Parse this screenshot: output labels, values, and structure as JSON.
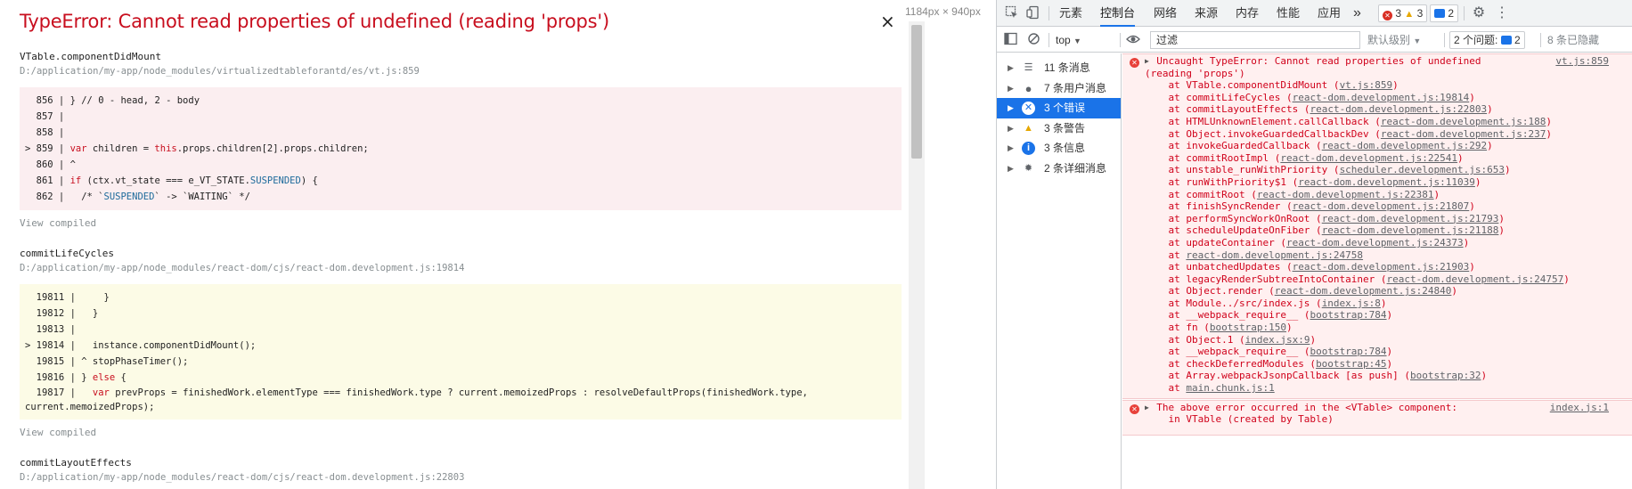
{
  "overlay": {
    "title": "TypeError: Cannot read properties of undefined (reading 'props')",
    "close_glyph": "×",
    "dims": "1184px × 940px",
    "view_compiled": "View compiled",
    "frames": [
      {
        "fn": "VTable.componentDidMount",
        "path": "D:/application/my-app/node_modules/virtualizedtableforantd/es/vt.js:859",
        "bg": "red",
        "lines": [
          {
            "prefix": "  856 | ",
            "code": "} // 0 - head, 2 - body"
          },
          {
            "prefix": "  857 | ",
            "code": ""
          },
          {
            "prefix": "  858 | ",
            "code": ""
          },
          {
            "prefix": "> 859 | ",
            "code": "var children = this.props.children[2].props.children;"
          },
          {
            "prefix": "  860 | ",
            "code": "^"
          },
          {
            "prefix": "  861 | ",
            "code": "if (ctx.vt_state === e_VT_STATE.SUSPENDED) {"
          },
          {
            "prefix": "  862 | ",
            "code": "  /* `SUSPENDED` -> `WAITING` */"
          }
        ]
      },
      {
        "fn": "commitLifeCycles",
        "path": "D:/application/my-app/node_modules/react-dom/cjs/react-dom.development.js:19814",
        "bg": "yellow",
        "lines": [
          {
            "prefix": "  19811 | ",
            "code": "    }"
          },
          {
            "prefix": "  19812 | ",
            "code": "  }"
          },
          {
            "prefix": "  19813 | ",
            "code": ""
          },
          {
            "prefix": "> 19814 | ",
            "code": "  instance.componentDidMount();"
          },
          {
            "prefix": "  19815 | ",
            "code": "^ stopPhaseTimer();"
          },
          {
            "prefix": "  19816 | ",
            "code": "} else {"
          },
          {
            "prefix": "  19817 | ",
            "code": "  var prevProps = finishedWork.elementType === finishedWork.type ? current.memoizedProps : resolveDefaultProps(finishedWork.type,\ncurrent.memoizedProps);"
          }
        ]
      },
      {
        "fn": "commitLayoutEffects",
        "path": "D:/application/my-app/node_modules/react-dom/cjs/react-dom.development.js:22803",
        "bg": "none",
        "lines": []
      }
    ]
  },
  "devtools": {
    "tabs": [
      "元素",
      "控制台",
      "网络",
      "来源",
      "内存",
      "性能",
      "应用"
    ],
    "active_tab": "控制台",
    "more_glyph": "»",
    "badges": {
      "errors": "3",
      "warnings": "3",
      "messages": "2"
    },
    "toolbar": {
      "context": "top",
      "filter_placeholder": "过滤",
      "level": "默认级别",
      "issues_label": "2 个问题:",
      "issues_count": "2",
      "hidden": "8 条已隐藏"
    },
    "sidebar": [
      {
        "icon": "list-icon",
        "glyph": "☰",
        "label": "11 条消息"
      },
      {
        "icon": "user-icon",
        "glyph": "●",
        "label": "7 条用户消息"
      },
      {
        "icon": "error-icon",
        "glyph": "✕",
        "label": "3 个错误",
        "active": true
      },
      {
        "icon": "warning-icon",
        "glyph": "▲",
        "label": "3 条警告"
      },
      {
        "icon": "info-icon",
        "glyph": "i",
        "label": "3 条信息"
      },
      {
        "icon": "verbose-icon",
        "glyph": "✹",
        "label": "2 条详细消息"
      }
    ],
    "console": {
      "error1": {
        "header": "Uncaught TypeError: Cannot read properties of undefined",
        "header2": "(reading 'props')",
        "source": "vt.js:859",
        "stack": [
          {
            "fn": "VTable.componentDidMount",
            "src": "vt.js:859"
          },
          {
            "fn": "commitLifeCycles",
            "src": "react-dom.development.js:19814"
          },
          {
            "fn": "commitLayoutEffects",
            "src": "react-dom.development.js:22803"
          },
          {
            "fn": "HTMLUnknownElement.callCallback",
            "src": "react-dom.development.js:188"
          },
          {
            "fn": "Object.invokeGuardedCallbackDev",
            "src": "react-dom.development.js:237"
          },
          {
            "fn": "invokeGuardedCallback",
            "src": "react-dom.development.js:292"
          },
          {
            "fn": "commitRootImpl",
            "src": "react-dom.development.js:22541"
          },
          {
            "fn": "unstable_runWithPriority",
            "src": "scheduler.development.js:653"
          },
          {
            "fn": "runWithPriority$1",
            "src": "react-dom.development.js:11039"
          },
          {
            "fn": "commitRoot",
            "src": "react-dom.development.js:22381"
          },
          {
            "fn": "finishSyncRender",
            "src": "react-dom.development.js:21807"
          },
          {
            "fn": "performSyncWorkOnRoot",
            "src": "react-dom.development.js:21793"
          },
          {
            "fn": "scheduleUpdateOnFiber",
            "src": "react-dom.development.js:21188"
          },
          {
            "fn": "updateContainer",
            "src": "react-dom.development.js:24373"
          },
          {
            "fn": "",
            "src": "react-dom.development.js:24758"
          },
          {
            "fn": "unbatchedUpdates",
            "src": "react-dom.development.js:21903"
          },
          {
            "fn": "legacyRenderSubtreeIntoContainer",
            "src": "react-dom.development.js:24757"
          },
          {
            "fn": "Object.render",
            "src": "react-dom.development.js:24840"
          },
          {
            "fn": "Module../src/index.js",
            "src": "index.js:8"
          },
          {
            "fn": "__webpack_require__",
            "src": "bootstrap:784"
          },
          {
            "fn": "fn",
            "src": "bootstrap:150"
          },
          {
            "fn": "Object.1",
            "src": "index.jsx:9"
          },
          {
            "fn": "__webpack_require__",
            "src": "bootstrap:784"
          },
          {
            "fn": "checkDeferredModules",
            "src": "bootstrap:45"
          },
          {
            "fn": "Array.webpackJsonpCallback [as push]",
            "src": "bootstrap:32"
          },
          {
            "fn": "",
            "src": "main.chunk.js:1"
          }
        ]
      },
      "error2": {
        "header": "The above error occurred in the <VTable> component:",
        "line2": "    in VTable (created by Table)",
        "source": "index.js:1"
      }
    }
  }
}
